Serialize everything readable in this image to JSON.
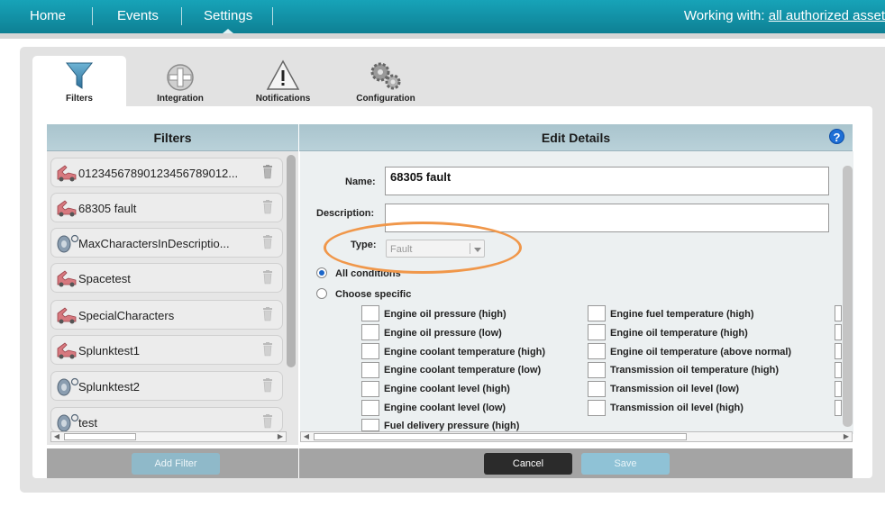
{
  "nav": {
    "items": [
      {
        "label": "Home"
      },
      {
        "label": "Events"
      },
      {
        "label": "Settings"
      }
    ],
    "working_prefix": "Working with:",
    "working_link": "all authorized asset"
  },
  "tabs": [
    {
      "label": "Filters",
      "icon": "funnel-icon",
      "active": true
    },
    {
      "label": "Integration",
      "icon": "integration-icon",
      "active": false
    },
    {
      "label": "Notifications",
      "icon": "warning-icon",
      "active": false
    },
    {
      "label": "Configuration",
      "icon": "gears-icon",
      "active": false
    }
  ],
  "filters_pane": {
    "title": "Filters",
    "items": [
      {
        "name": "01234567890123456789012...",
        "icon": "truck-fault-icon"
      },
      {
        "name": "68305 fault",
        "icon": "truck-fault-icon"
      },
      {
        "name": "MaxCharactersInDescriptio...",
        "icon": "tire-icon"
      },
      {
        "name": "Spacetest",
        "icon": "truck-fault-icon"
      },
      {
        "name": "SpecialCharacters",
        "icon": "truck-fault-icon"
      },
      {
        "name": "Splunktest1",
        "icon": "truck-fault-icon"
      },
      {
        "name": "Splunktest2",
        "icon": "tire-icon"
      },
      {
        "name": "test",
        "icon": "tire-icon"
      }
    ],
    "add_button": "Add Filter"
  },
  "edit_pane": {
    "title": "Edit Details",
    "help": "?",
    "name_label": "Name:",
    "name_value": "68305 fault",
    "description_label": "Description:",
    "description_value": "",
    "type_label": "Type:",
    "type_value": "Fault",
    "all_conditions": "All conditions",
    "choose_specific": "Choose specific",
    "conditions_col1": [
      "Engine oil pressure (high)",
      "Engine oil pressure (low)",
      "Engine coolant temperature (high)",
      "Engine coolant temperature (low)",
      "Engine coolant level (high)",
      "Engine coolant level (low)",
      "Fuel delivery pressure (high)"
    ],
    "conditions_col2": [
      "Engine fuel temperature (high)",
      "Engine oil temperature (high)",
      "Engine oil temperature (above normal)",
      "Transmission oil temperature (high)",
      "Transmission oil level (low)",
      "Transmission oil level (high)"
    ],
    "cancel_button": "Cancel",
    "save_button": "Save"
  },
  "colors": {
    "nav_bg": "#0e8094",
    "highlight_oval": "#f0974a",
    "save_button": "#8fc2d6",
    "cancel_button": "#2b2b2b"
  }
}
